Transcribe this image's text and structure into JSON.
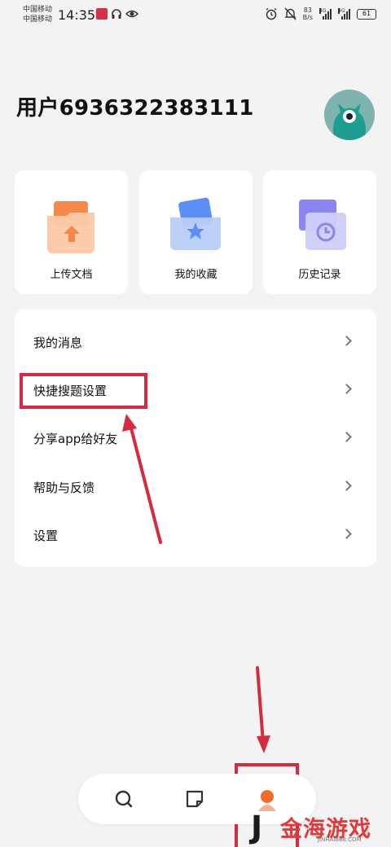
{
  "status_bar": {
    "carrier_1": "中国移动",
    "carrier_2": "中国移动",
    "time": "14:35",
    "net_speed_value": "83",
    "net_speed_unit": "B/s",
    "signal_1": "4G",
    "signal_2": "4G",
    "battery": "61"
  },
  "profile": {
    "username": "用户6936322383111",
    "avatar_icon": "monster-avatar-icon"
  },
  "quick_cards": [
    {
      "label": "上传文档",
      "icon": "upload-folder-icon",
      "color": "#f6894a"
    },
    {
      "label": "我的收藏",
      "icon": "star-folder-icon",
      "color": "#5b8ff5"
    },
    {
      "label": "历史记录",
      "icon": "history-clock-icon",
      "color": "#8a85f0"
    }
  ],
  "menu": [
    {
      "label": "我的消息"
    },
    {
      "label": "快捷搜题设置"
    },
    {
      "label": "分享app给好友"
    },
    {
      "label": "帮助与反馈"
    },
    {
      "label": "设置"
    }
  ],
  "bottom_nav": [
    {
      "name": "search",
      "icon": "search-icon"
    },
    {
      "name": "notes",
      "icon": "note-icon"
    },
    {
      "name": "profile",
      "icon": "profile-icon",
      "active": true
    }
  ],
  "watermark": {
    "letter": "J",
    "text": "金海游戏",
    "sub": "JINHAI888.COM"
  },
  "colors": {
    "annotation_red": "#d82a3f",
    "background": "#f3f3f3",
    "accent_orange": "#f26b2e"
  }
}
